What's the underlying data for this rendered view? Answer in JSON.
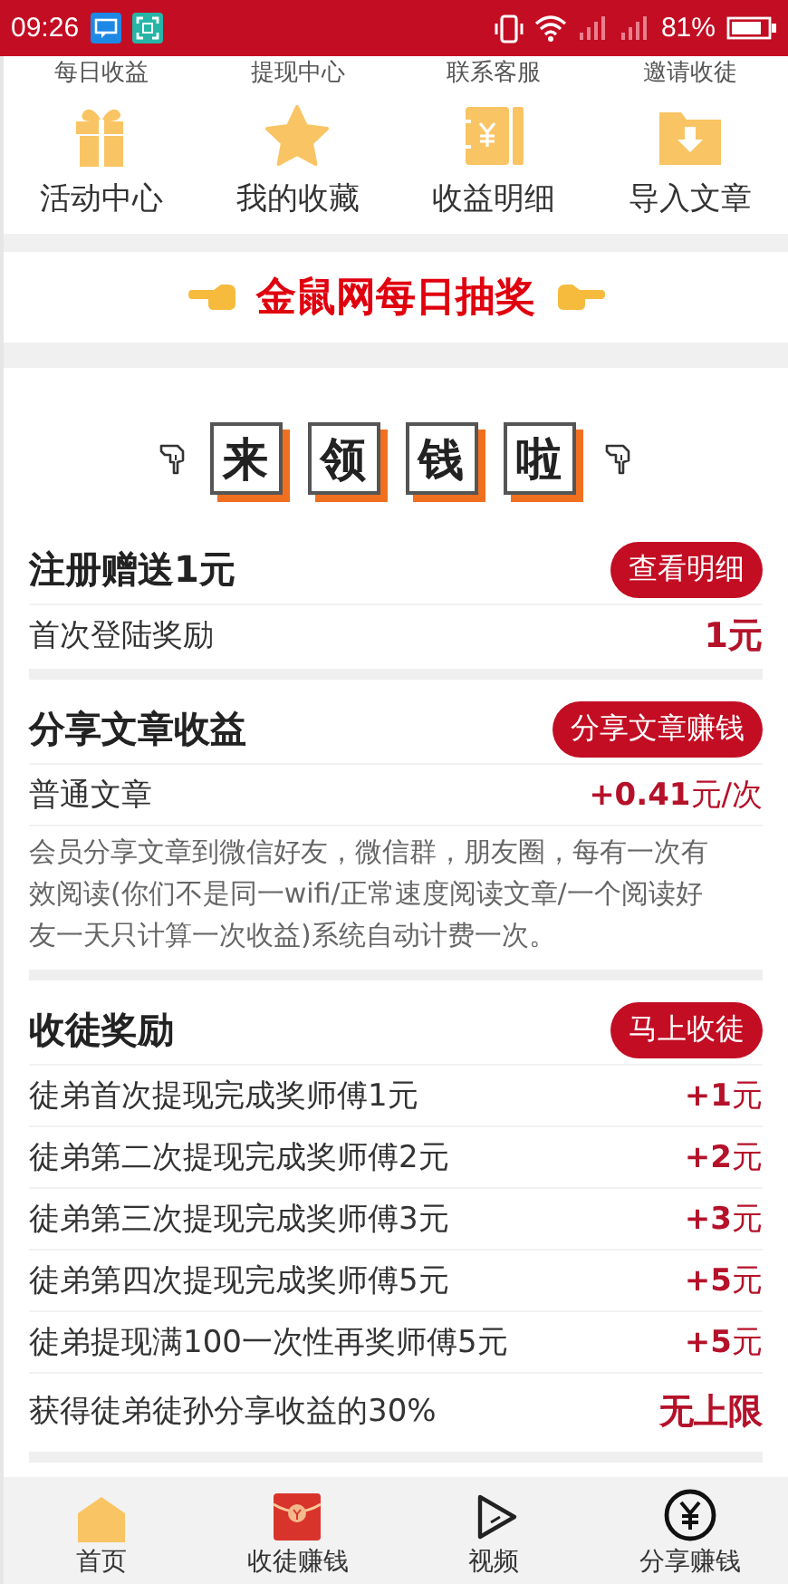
{
  "status_bar": {
    "time": "09:26",
    "battery": "81%"
  },
  "top_links": [
    "每日收益",
    "提现中心",
    "联系客服",
    "邀请收徒"
  ],
  "shortcuts": [
    {
      "label": "活动中心",
      "kind": "gift"
    },
    {
      "label": "我的收藏",
      "kind": "star"
    },
    {
      "label": "收益明细",
      "kind": "ledger"
    },
    {
      "label": "导入文章",
      "kind": "folder"
    }
  ],
  "banner": {
    "title": "金鼠网每日抽奖"
  },
  "headline": {
    "characters": [
      "来",
      "领",
      "钱",
      "啦"
    ]
  },
  "sections": [
    {
      "title": "注册赠送1元",
      "button": "查看明细",
      "rows": [
        {
          "label": "首次登陆奖励",
          "amount": "1元",
          "emphasis": true
        }
      ]
    },
    {
      "title": "分享文章收益",
      "button": "分享文章赚钱",
      "rows": [
        {
          "label": "普通文章",
          "amount": "**+0.41**元/次",
          "emphasis": false
        }
      ],
      "note": "会员分享文章到微信好友，微信群，朋友圈，每有一次有效阅读(你们不是同一wifi/正常速度阅读文章/一个阅读好友一天只计算一次收益)系统自动计费一次。"
    },
    {
      "title": "收徒奖励",
      "button": "马上收徒",
      "rows": [
        {
          "label": "徒弟首次提现完成奖师傅1元",
          "amount": "**+1**元",
          "emphasis": false
        },
        {
          "label": "徒弟第二次提现完成奖师傅2元",
          "amount": "**+2**元",
          "emphasis": false
        },
        {
          "label": "徒弟第三次提现完成奖师傅3元",
          "amount": "**+3**元",
          "emphasis": false
        },
        {
          "label": "徒弟第四次提现完成奖师傅5元",
          "amount": "**+5**元",
          "emphasis": false
        },
        {
          "label": "徒弟提现满100一次性再奖师傅5元",
          "amount": "**+5**元",
          "emphasis": false
        },
        {
          "label": "获得徒弟徒孙分享收益的30%",
          "amount": "无上限",
          "emphasis": true
        }
      ]
    }
  ],
  "bottom_nav": [
    {
      "label": "首页",
      "kind": "home"
    },
    {
      "label": "收徒赚钱",
      "kind": "envelope"
    },
    {
      "label": "视频",
      "kind": "play"
    },
    {
      "label": "分享赚钱",
      "kind": "yuan"
    }
  ]
}
